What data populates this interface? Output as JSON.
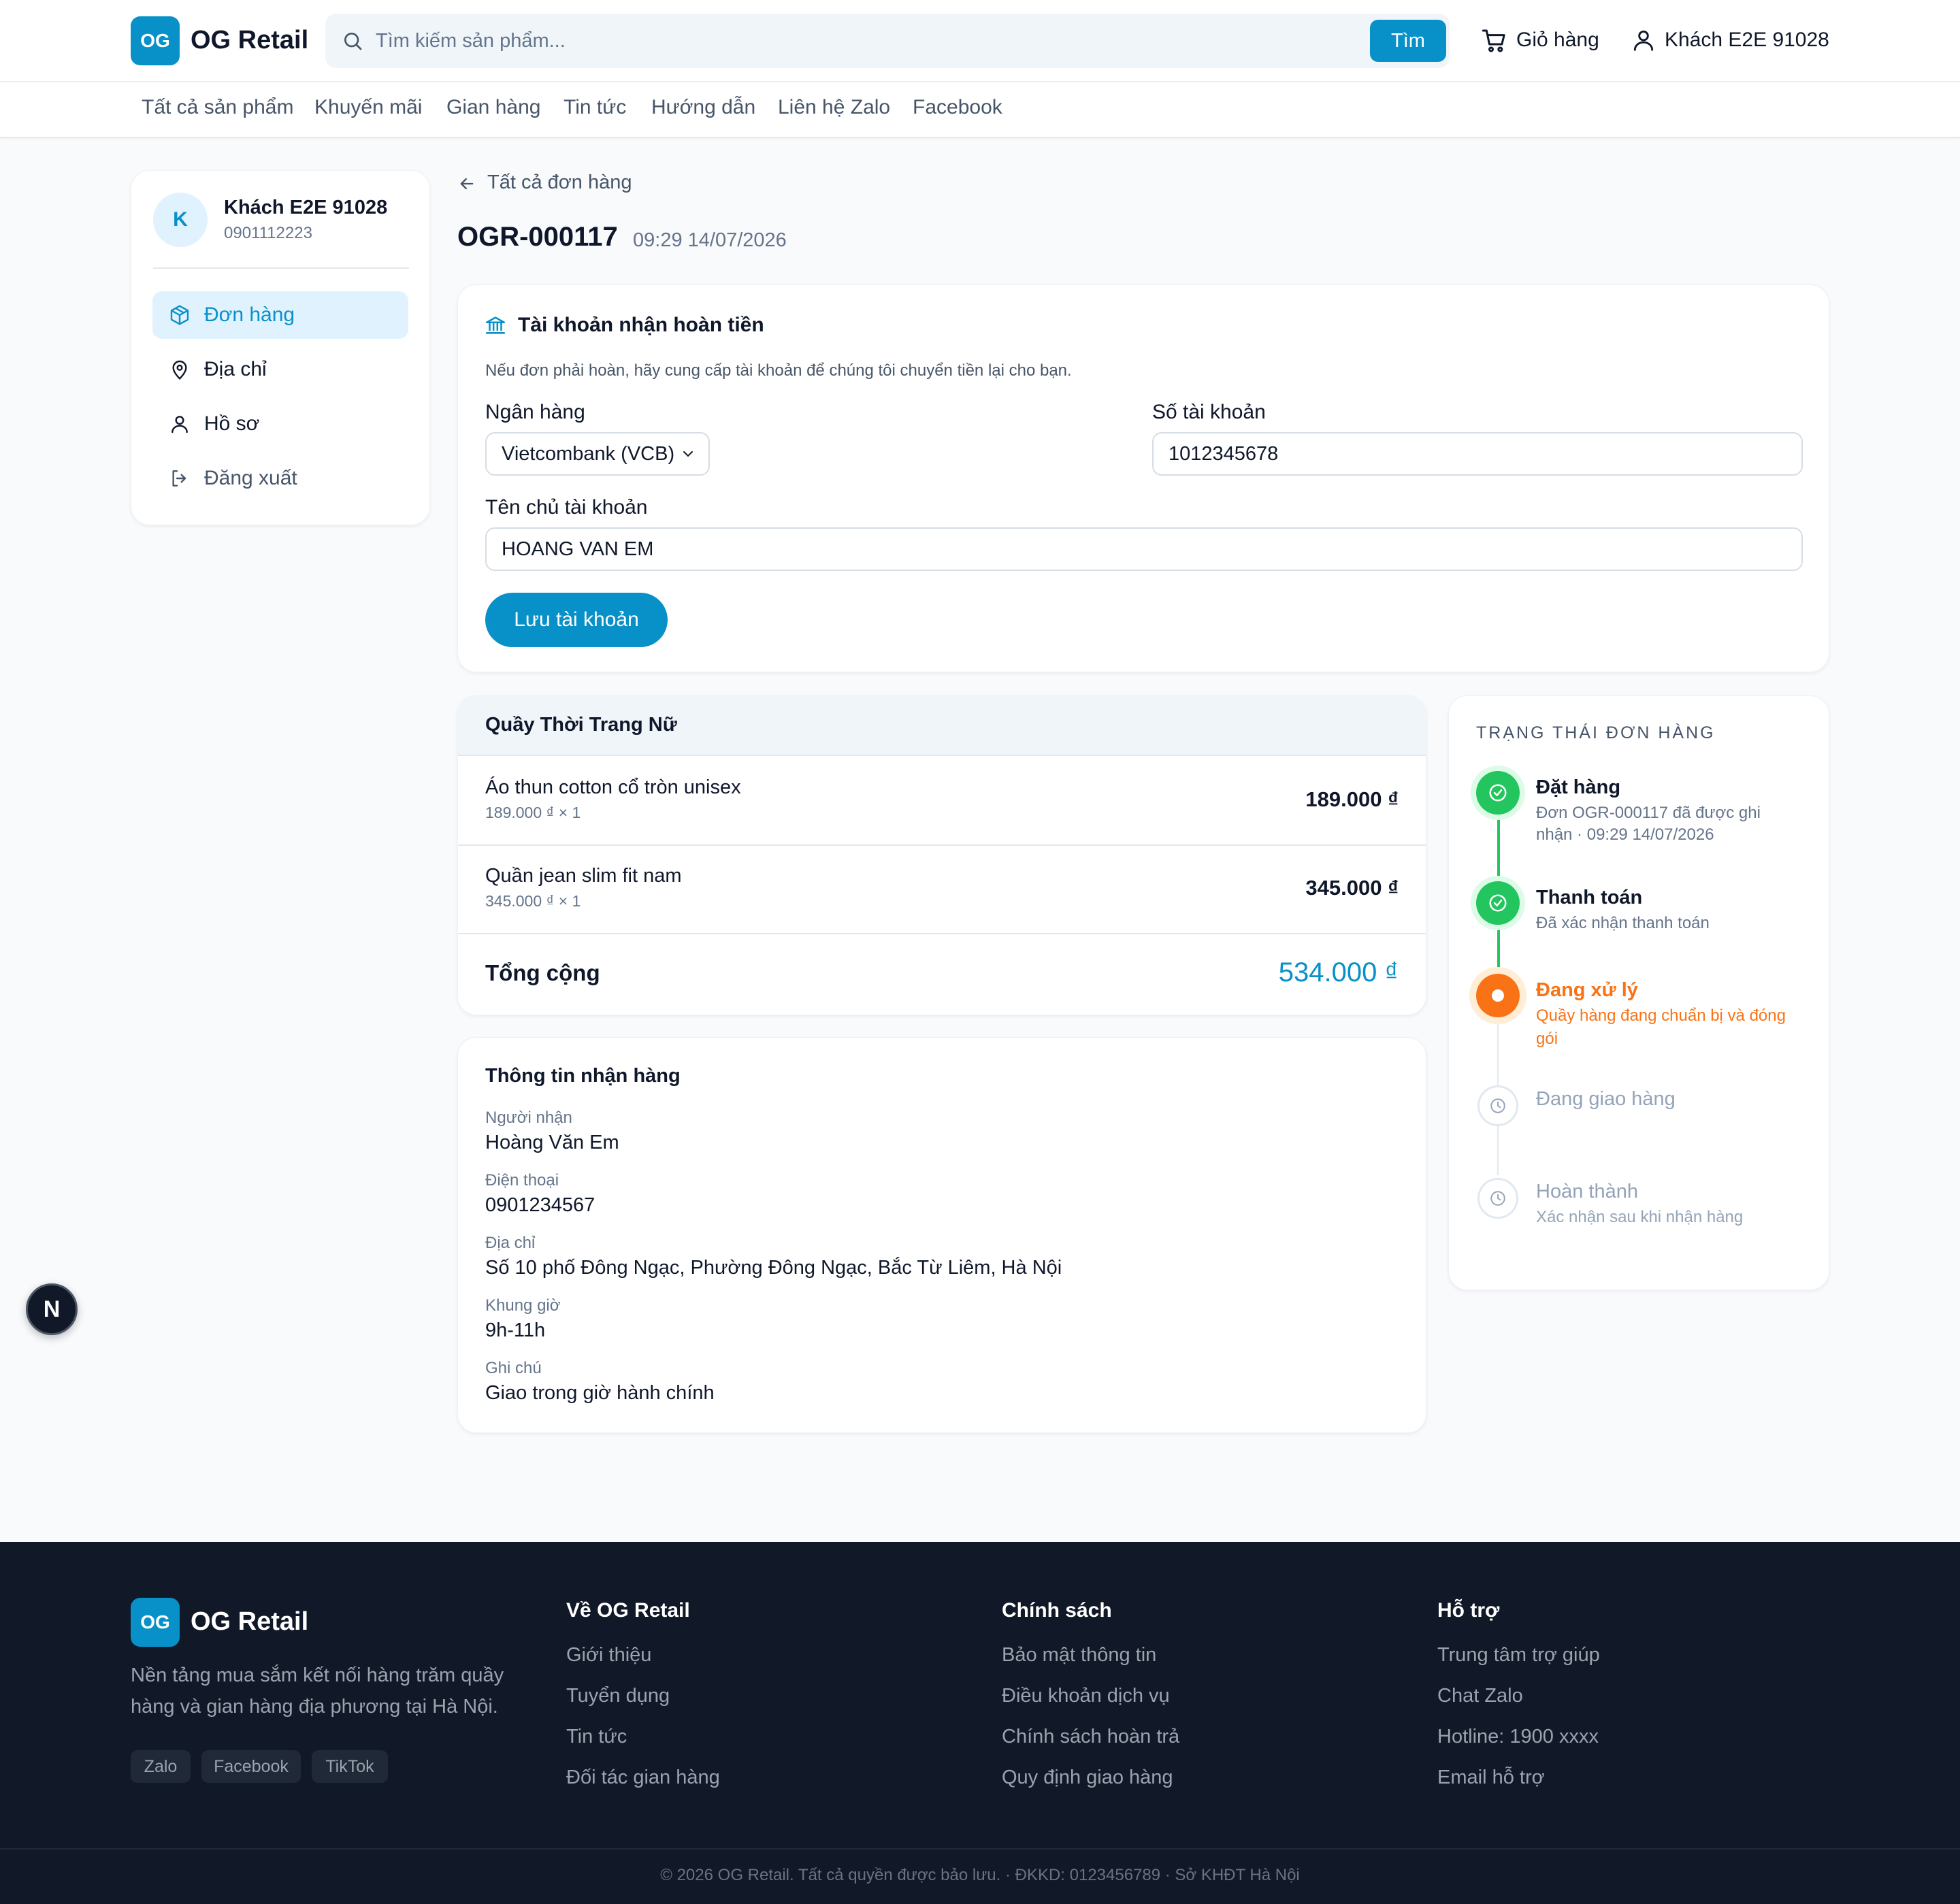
{
  "brand": {
    "logo_badge": "OG",
    "name": "OG Retail",
    "color": "#0891c8"
  },
  "header": {
    "search_placeholder": "Tìm kiếm sản phẩm...",
    "search_button": "Tìm",
    "cart_label": "Giỏ hàng",
    "user_label": "Khách E2E 91028"
  },
  "nav": {
    "items": [
      "Tất cả sản phẩm",
      "Khuyến mãi",
      "Gian hàng",
      "Tin tức",
      "Hướng dẫn",
      "Liên hệ Zalo",
      "Facebook"
    ]
  },
  "sidebar": {
    "avatar_letter": "K",
    "user_name": "Khách E2E 91028",
    "user_phone": "0901112223",
    "items": [
      {
        "label": "Đơn hàng",
        "icon": "package-icon",
        "active": true
      },
      {
        "label": "Địa chỉ",
        "icon": "map-pin-icon",
        "active": false
      },
      {
        "label": "Hồ sơ",
        "icon": "user-icon",
        "active": false
      },
      {
        "label": "Đăng xuất",
        "icon": "logout-icon",
        "active": false
      }
    ]
  },
  "order": {
    "back_link": "Tất cả đơn hàng",
    "code": "OGR-000117",
    "datetime": "09:29 14/07/2026"
  },
  "refund": {
    "title": "Tài khoản nhận hoàn tiền",
    "description": "Nếu đơn phải hoàn, hãy cung cấp tài khoản để chúng tôi chuyển tiền lại cho bạn.",
    "bank_label": "Ngân hàng",
    "bank_value": "Vietcombank (VCB)",
    "account_no_label": "Số tài khoản",
    "account_no_value": "1012345678",
    "holder_label": "Tên chủ tài khoản",
    "holder_value": "HOANG VAN EM",
    "save_button": "Lưu tài khoản"
  },
  "items_card": {
    "shop_name": "Quầy Thời Trang Nữ",
    "items": [
      {
        "name": "Áo thun cotton cổ tròn unisex",
        "unit": "189.000 ₫ × 1",
        "price": "189.000 ₫"
      },
      {
        "name": "Quần jean slim fit nam",
        "unit": "345.000 ₫ × 1",
        "price": "345.000 ₫"
      }
    ],
    "total_label": "Tổng cộng",
    "total_value": "534.000 ₫"
  },
  "shipping": {
    "title": "Thông tin nhận hàng",
    "fields": [
      {
        "label": "Người nhận",
        "value": "Hoàng Văn Em"
      },
      {
        "label": "Điện thoại",
        "value": "0901234567"
      },
      {
        "label": "Địa chỉ",
        "value": "Số 10 phố Đông Ngạc, Phường Đông Ngạc, Bắc Từ Liêm, Hà Nội"
      },
      {
        "label": "Khung giờ",
        "value": "9h-11h"
      },
      {
        "label": "Ghi chú",
        "value": "Giao trong giờ hành chính"
      }
    ]
  },
  "status": {
    "title": "TRẠNG THÁI ĐƠN HÀNG",
    "colors": {
      "done": "#22c55e",
      "current": "#f97316",
      "pending": "#cbd5e1"
    },
    "steps": [
      {
        "title": "Đặt hàng",
        "desc_line1": "Đơn OGR-000117 đã được ghi",
        "desc_line2": "nhận · 09:29 14/07/2026",
        "state": "done",
        "icon": "check-icon"
      },
      {
        "title": "Thanh toán",
        "desc_line1": "Đã xác nhận thanh toán",
        "desc_line2": "",
        "state": "done",
        "icon": "check-icon"
      },
      {
        "title": "Đang xử lý",
        "desc_line1": "Quầy hàng đang chuẩn bị và đóng",
        "desc_line2": "gói",
        "state": "current",
        "icon": "dot-icon"
      },
      {
        "title": "Đang giao hàng",
        "desc_line1": "",
        "desc_line2": "",
        "state": "pending",
        "icon": "clock-icon"
      },
      {
        "title": "Hoàn thành",
        "desc_line1": "Xác nhận sau khi nhận hàng",
        "desc_line2": "",
        "state": "pending",
        "icon": "clock-icon"
      }
    ]
  },
  "floating": {
    "badge_letter": "N"
  },
  "footer": {
    "description_line1": "Nền tảng mua sắm kết nối hàng trăm quầy",
    "description_line2": "hàng và gian hàng địa phương tại Hà Nội.",
    "socials": [
      "Zalo",
      "Facebook",
      "TikTok"
    ],
    "columns": [
      {
        "title": "Về OG Retail",
        "links": [
          "Giới thiệu",
          "Tuyển dụng",
          "Tin tức",
          "Đối tác gian hàng"
        ]
      },
      {
        "title": "Chính sách",
        "links": [
          "Bảo mật thông tin",
          "Điều khoản dịch vụ",
          "Chính sách hoàn trả",
          "Quy định giao hàng"
        ]
      },
      {
        "title": "Hỗ trợ",
        "links": [
          "Trung tâm trợ giúp",
          "Chat Zalo",
          "Hotline: 1900 xxxx",
          "Email hỗ trợ"
        ]
      }
    ],
    "copyright": "© 2026 OG Retail. Tất cả quyền được bảo lưu. · ĐKKD: 0123456789 · Sở KHĐT Hà Nội"
  }
}
